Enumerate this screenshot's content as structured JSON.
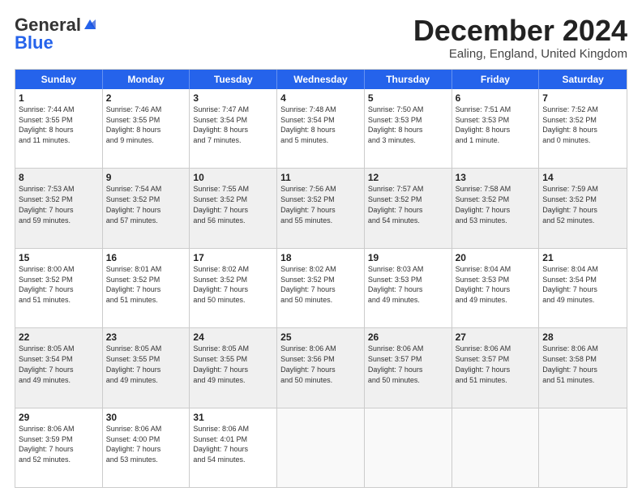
{
  "logo": {
    "line1": "General",
    "line2": "Blue"
  },
  "header": {
    "month": "December 2024",
    "location": "Ealing, England, United Kingdom"
  },
  "days": [
    "Sunday",
    "Monday",
    "Tuesday",
    "Wednesday",
    "Thursday",
    "Friday",
    "Saturday"
  ],
  "rows": [
    [
      {
        "day": "1",
        "info": "Sunrise: 7:44 AM\nSunset: 3:55 PM\nDaylight: 8 hours\nand 11 minutes.",
        "shaded": false
      },
      {
        "day": "2",
        "info": "Sunrise: 7:46 AM\nSunset: 3:55 PM\nDaylight: 8 hours\nand 9 minutes.",
        "shaded": false
      },
      {
        "day": "3",
        "info": "Sunrise: 7:47 AM\nSunset: 3:54 PM\nDaylight: 8 hours\nand 7 minutes.",
        "shaded": false
      },
      {
        "day": "4",
        "info": "Sunrise: 7:48 AM\nSunset: 3:54 PM\nDaylight: 8 hours\nand 5 minutes.",
        "shaded": false
      },
      {
        "day": "5",
        "info": "Sunrise: 7:50 AM\nSunset: 3:53 PM\nDaylight: 8 hours\nand 3 minutes.",
        "shaded": false
      },
      {
        "day": "6",
        "info": "Sunrise: 7:51 AM\nSunset: 3:53 PM\nDaylight: 8 hours\nand 1 minute.",
        "shaded": false
      },
      {
        "day": "7",
        "info": "Sunrise: 7:52 AM\nSunset: 3:52 PM\nDaylight: 8 hours\nand 0 minutes.",
        "shaded": false
      }
    ],
    [
      {
        "day": "8",
        "info": "Sunrise: 7:53 AM\nSunset: 3:52 PM\nDaylight: 7 hours\nand 59 minutes.",
        "shaded": true
      },
      {
        "day": "9",
        "info": "Sunrise: 7:54 AM\nSunset: 3:52 PM\nDaylight: 7 hours\nand 57 minutes.",
        "shaded": true
      },
      {
        "day": "10",
        "info": "Sunrise: 7:55 AM\nSunset: 3:52 PM\nDaylight: 7 hours\nand 56 minutes.",
        "shaded": true
      },
      {
        "day": "11",
        "info": "Sunrise: 7:56 AM\nSunset: 3:52 PM\nDaylight: 7 hours\nand 55 minutes.",
        "shaded": true
      },
      {
        "day": "12",
        "info": "Sunrise: 7:57 AM\nSunset: 3:52 PM\nDaylight: 7 hours\nand 54 minutes.",
        "shaded": true
      },
      {
        "day": "13",
        "info": "Sunrise: 7:58 AM\nSunset: 3:52 PM\nDaylight: 7 hours\nand 53 minutes.",
        "shaded": true
      },
      {
        "day": "14",
        "info": "Sunrise: 7:59 AM\nSunset: 3:52 PM\nDaylight: 7 hours\nand 52 minutes.",
        "shaded": true
      }
    ],
    [
      {
        "day": "15",
        "info": "Sunrise: 8:00 AM\nSunset: 3:52 PM\nDaylight: 7 hours\nand 51 minutes.",
        "shaded": false
      },
      {
        "day": "16",
        "info": "Sunrise: 8:01 AM\nSunset: 3:52 PM\nDaylight: 7 hours\nand 51 minutes.",
        "shaded": false
      },
      {
        "day": "17",
        "info": "Sunrise: 8:02 AM\nSunset: 3:52 PM\nDaylight: 7 hours\nand 50 minutes.",
        "shaded": false
      },
      {
        "day": "18",
        "info": "Sunrise: 8:02 AM\nSunset: 3:52 PM\nDaylight: 7 hours\nand 50 minutes.",
        "shaded": false
      },
      {
        "day": "19",
        "info": "Sunrise: 8:03 AM\nSunset: 3:53 PM\nDaylight: 7 hours\nand 49 minutes.",
        "shaded": false
      },
      {
        "day": "20",
        "info": "Sunrise: 8:04 AM\nSunset: 3:53 PM\nDaylight: 7 hours\nand 49 minutes.",
        "shaded": false
      },
      {
        "day": "21",
        "info": "Sunrise: 8:04 AM\nSunset: 3:54 PM\nDaylight: 7 hours\nand 49 minutes.",
        "shaded": false
      }
    ],
    [
      {
        "day": "22",
        "info": "Sunrise: 8:05 AM\nSunset: 3:54 PM\nDaylight: 7 hours\nand 49 minutes.",
        "shaded": true
      },
      {
        "day": "23",
        "info": "Sunrise: 8:05 AM\nSunset: 3:55 PM\nDaylight: 7 hours\nand 49 minutes.",
        "shaded": true
      },
      {
        "day": "24",
        "info": "Sunrise: 8:05 AM\nSunset: 3:55 PM\nDaylight: 7 hours\nand 49 minutes.",
        "shaded": true
      },
      {
        "day": "25",
        "info": "Sunrise: 8:06 AM\nSunset: 3:56 PM\nDaylight: 7 hours\nand 50 minutes.",
        "shaded": true
      },
      {
        "day": "26",
        "info": "Sunrise: 8:06 AM\nSunset: 3:57 PM\nDaylight: 7 hours\nand 50 minutes.",
        "shaded": true
      },
      {
        "day": "27",
        "info": "Sunrise: 8:06 AM\nSunset: 3:57 PM\nDaylight: 7 hours\nand 51 minutes.",
        "shaded": true
      },
      {
        "day": "28",
        "info": "Sunrise: 8:06 AM\nSunset: 3:58 PM\nDaylight: 7 hours\nand 51 minutes.",
        "shaded": true
      }
    ],
    [
      {
        "day": "29",
        "info": "Sunrise: 8:06 AM\nSunset: 3:59 PM\nDaylight: 7 hours\nand 52 minutes.",
        "shaded": false
      },
      {
        "day": "30",
        "info": "Sunrise: 8:06 AM\nSunset: 4:00 PM\nDaylight: 7 hours\nand 53 minutes.",
        "shaded": false
      },
      {
        "day": "31",
        "info": "Sunrise: 8:06 AM\nSunset: 4:01 PM\nDaylight: 7 hours\nand 54 minutes.",
        "shaded": false
      },
      {
        "day": "",
        "info": "",
        "shaded": false,
        "empty": true
      },
      {
        "day": "",
        "info": "",
        "shaded": false,
        "empty": true
      },
      {
        "day": "",
        "info": "",
        "shaded": false,
        "empty": true
      },
      {
        "day": "",
        "info": "",
        "shaded": false,
        "empty": true
      }
    ]
  ]
}
